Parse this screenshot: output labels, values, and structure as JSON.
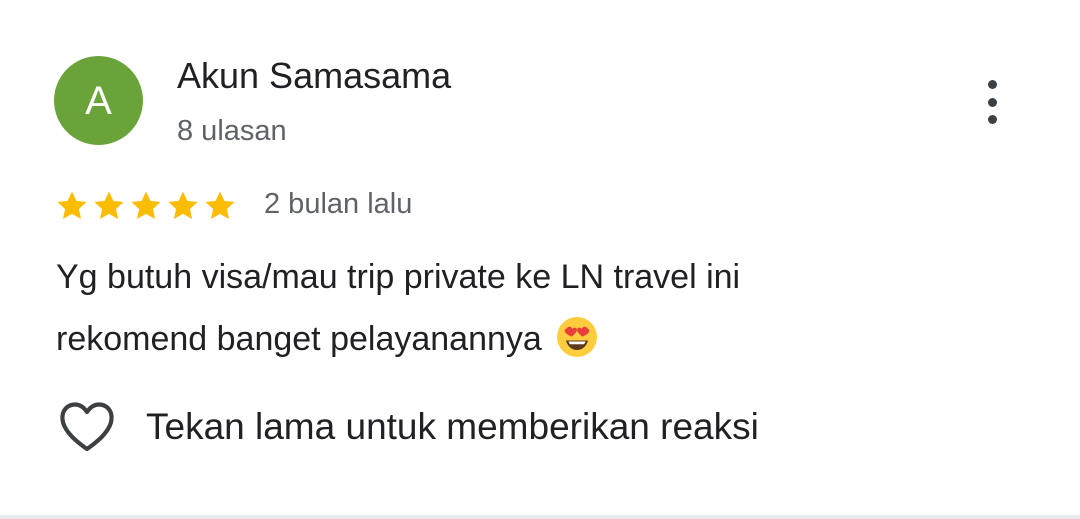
{
  "review": {
    "avatar_letter": "A",
    "author_name": "Akun Samasama",
    "author_review_count": "8 ulasan",
    "rating": 5,
    "rating_max": 5,
    "time_ago": "2 bulan lalu",
    "text_line_1": "Yg butuh visa/mau trip private ke LN travel ini",
    "text_line_2": "rekomend banget pelayanannya",
    "emoji": "smiling-face-with-heart-eyes"
  },
  "actions": {
    "more_icon": "more-vertical-icon",
    "reaction_icon": "heart-outline-icon",
    "reaction_label": "Tekan lama untuk memberikan reaksi"
  },
  "colors": {
    "avatar_bg": "#6aa339",
    "star": "#fbbc04",
    "primary_text": "#202124",
    "secondary_text": "#5f6368"
  }
}
